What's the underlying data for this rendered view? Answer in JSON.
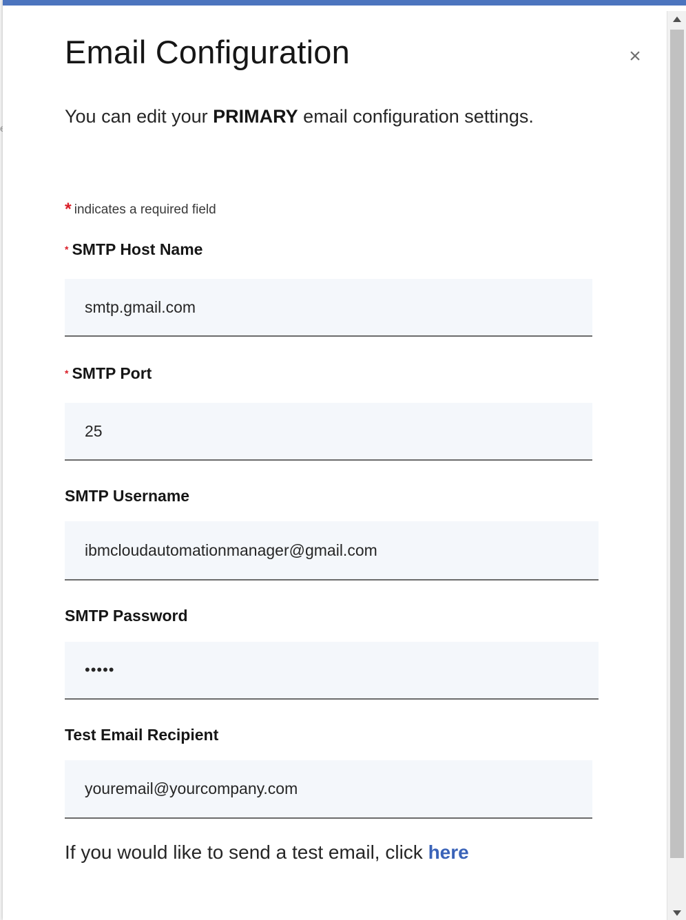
{
  "backdrop": {
    "fragment": "e"
  },
  "modal": {
    "title": "Email Configuration",
    "close_icon": "×",
    "subtitle_pre": "You can edit your ",
    "subtitle_bold": "PRIMARY",
    "subtitle_post": " email configuration settings.",
    "required_star": "*",
    "required_note": "indicates a required field"
  },
  "fields": [
    {
      "label": "SMTP Host Name",
      "required": true,
      "value": "smtp.gmail.com"
    },
    {
      "label": "SMTP Port",
      "required": true,
      "value": "25"
    },
    {
      "label": "SMTP Username",
      "required": false,
      "value": "ibmcloudautomationmanager@gmail.com"
    },
    {
      "label": "SMTP Password",
      "required": false,
      "value": "•••••"
    },
    {
      "label": "Test Email Recipient",
      "required": false,
      "value": "youremail@yourcompany.com"
    }
  ],
  "footer": {
    "text": "If you would like to send a test email, click ",
    "link": "here"
  },
  "colors": {
    "accent_bar": "#4c74be",
    "required_star": "#da1e28",
    "link": "#3a63b8",
    "field_bg": "#f4f7fb"
  },
  "icons": {
    "close": "close-icon",
    "scroll_up": "chevron-up-icon",
    "scroll_down": "chevron-down-icon"
  }
}
